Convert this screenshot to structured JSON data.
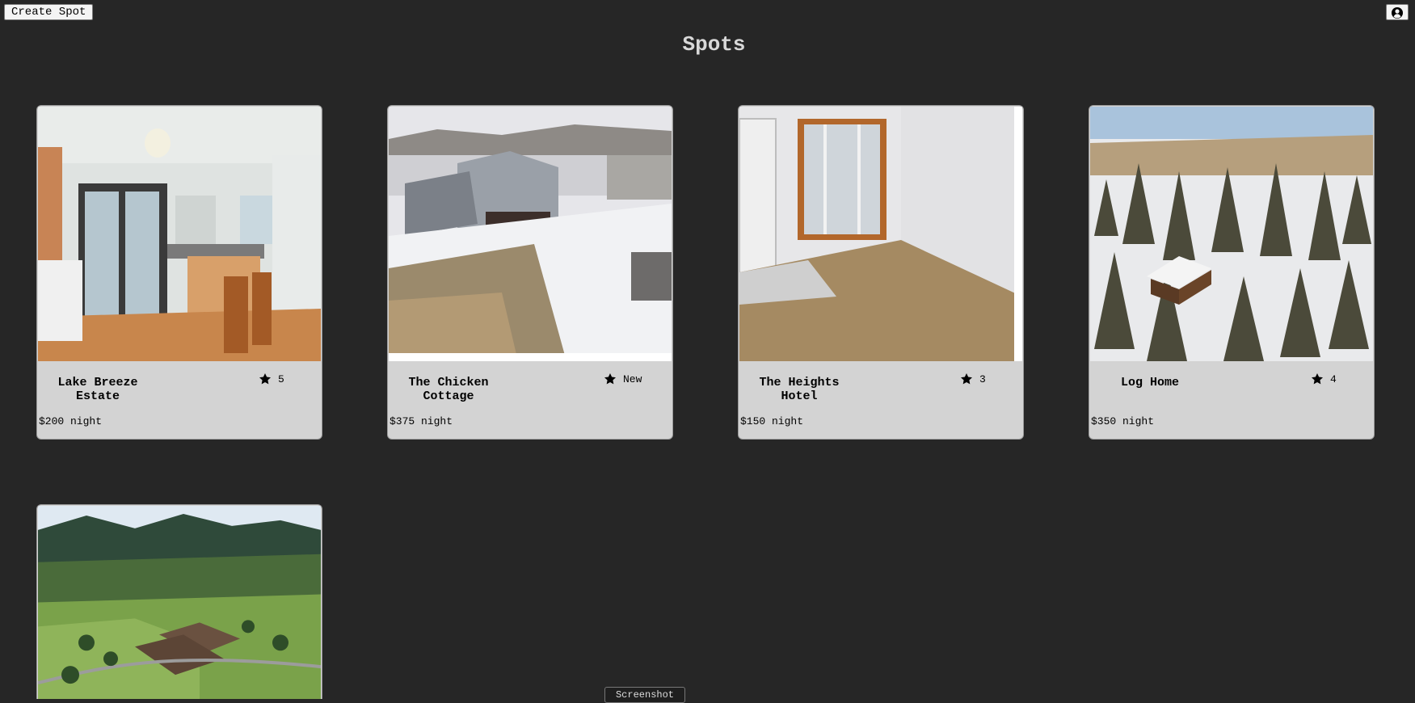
{
  "header": {
    "create_label": "Create Spot",
    "profile_icon": "user-circle-icon",
    "title": "Spots"
  },
  "spots": [
    {
      "name": "Lake Breeze Estate",
      "rating": "5",
      "price": "$200 night"
    },
    {
      "name": "The Chicken Cottage",
      "rating": "New",
      "price": "$375 night"
    },
    {
      "name": "The Heights Hotel",
      "rating": "3",
      "price": "$150 night"
    },
    {
      "name": "Log Home",
      "rating": "4",
      "price": "$350 night"
    }
  ],
  "footer": {
    "screenshot_label": "Screenshot"
  },
  "colors": {
    "background": "#262626",
    "card": "#d3d3d3",
    "title": "#d8d8d8"
  }
}
